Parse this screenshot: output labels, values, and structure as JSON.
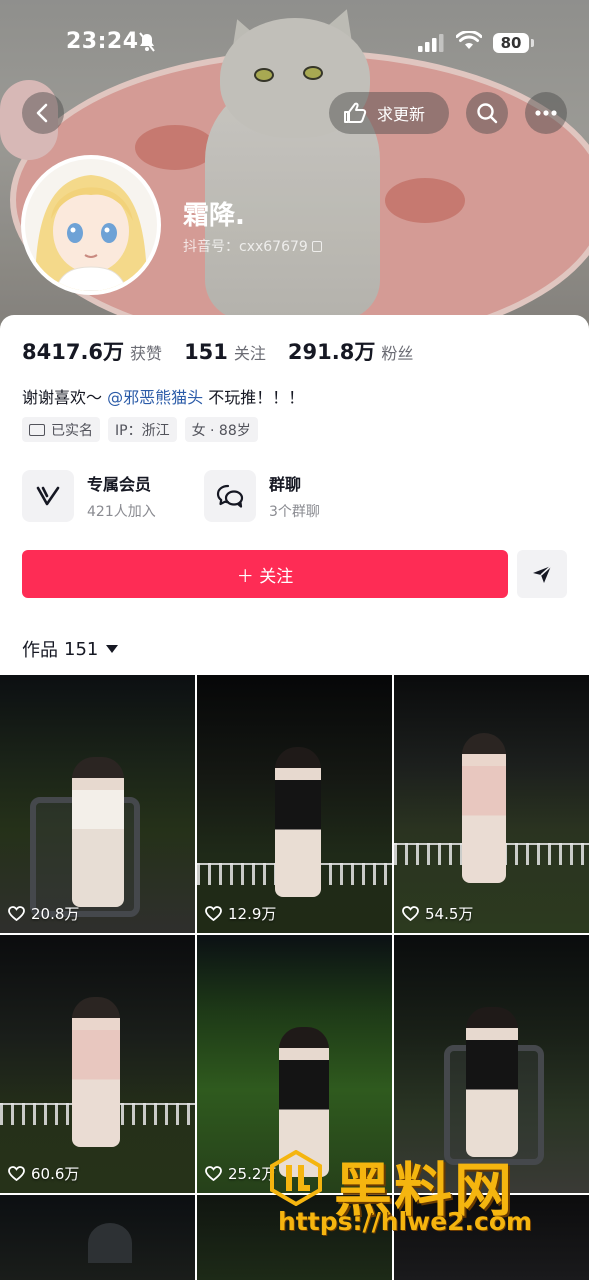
{
  "status_bar": {
    "time": "23:24",
    "battery": "80"
  },
  "nav": {
    "back_icon": "chevron-left-icon",
    "update_request_label": "求更新",
    "search_icon": "search-icon",
    "more_icon": "more-dots-icon"
  },
  "profile": {
    "name": "霜降.",
    "douyin_id": "抖音号：cxx67679",
    "stats": [
      {
        "value": "8417.6万",
        "label": "获赞"
      },
      {
        "value": "151",
        "label": "关注"
      },
      {
        "value": "291.8万",
        "label": "粉丝"
      }
    ],
    "bio_prefix": "谢谢喜欢～",
    "bio_mention": "@邪恶熊猫头",
    "bio_suffix": "不玩推！！！",
    "tags": [
      "已实名",
      "IP：浙江",
      "女 · 88岁"
    ]
  },
  "features": [
    {
      "title": "专属会员",
      "subtitle": "421人加入",
      "icon": "vip-v-icon"
    },
    {
      "title": "群聊",
      "subtitle": "3个群聊",
      "icon": "chat-bubbles-icon"
    }
  ],
  "actions": {
    "follow_label": "＋ 关注",
    "share_icon": "send-arrow-icon"
  },
  "works": {
    "label": "作品",
    "count": "151"
  },
  "videos": [
    {
      "likes": "20.8万"
    },
    {
      "likes": "12.9万"
    },
    {
      "likes": "54.5万"
    },
    {
      "likes": "60.6万"
    },
    {
      "likes": "25.2万"
    },
    {
      "likes": ""
    }
  ],
  "watermark": {
    "title": "黑料网",
    "url": "https://hlwe2.com"
  },
  "colors": {
    "accent_red": "#fe2c55",
    "mention_blue": "#2b5ba8",
    "watermark_gold": "#f5b50f"
  }
}
